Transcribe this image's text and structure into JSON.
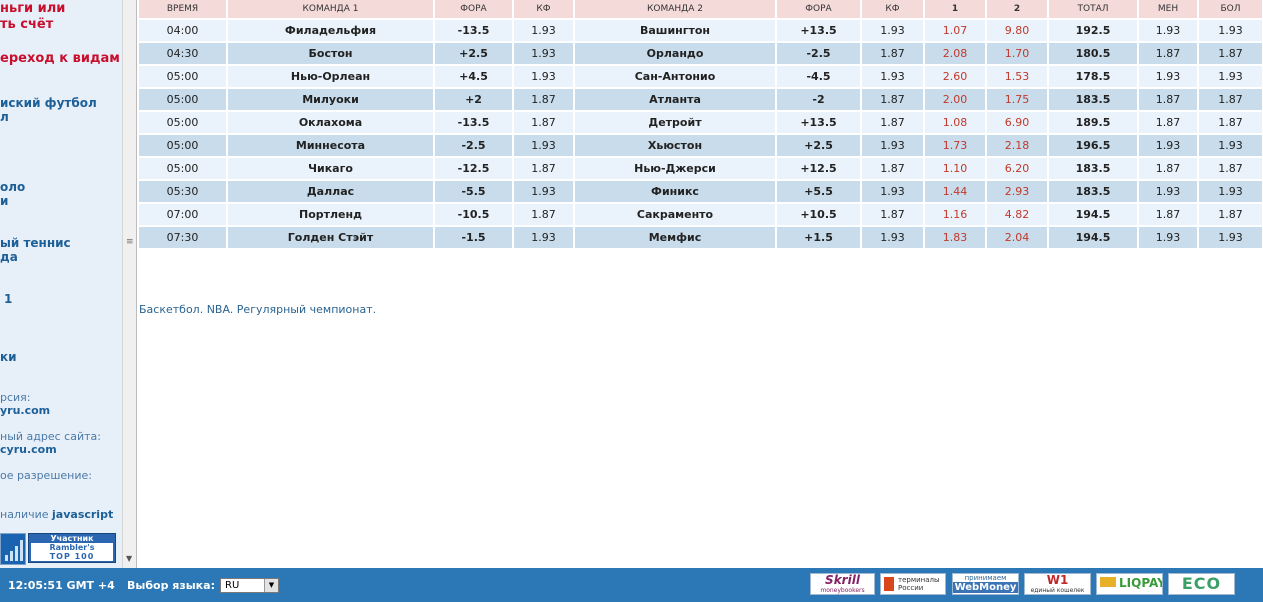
{
  "sidebar": {
    "items": [
      {
        "text": "ньги или",
        "style": "red"
      },
      {
        "text": "ть счёт",
        "style": "red"
      },
      {
        "text": "ереход к видам",
        "style": "red"
      },
      {
        "text": "иский футбол",
        "style": "blue"
      },
      {
        "text": "л",
        "style": "blue"
      },
      {
        "text": "оло",
        "style": "blue"
      },
      {
        "text": "и",
        "style": "blue"
      },
      {
        "text": "ый теннис",
        "style": "blue"
      },
      {
        "text": "да",
        "style": "blue"
      },
      {
        "text": "1",
        "style": "blue"
      },
      {
        "text": "ки",
        "style": "blue"
      }
    ],
    "mirror_label": "рсия:",
    "mirror_site": "yru.com",
    "address_label": "ный адрес сайта:",
    "address_site": "cyru.com",
    "resolution_label": "ое разрешение:",
    "js_prefix": "наличие ",
    "js_word": "javascript",
    "rambler": {
      "line1": "Участник",
      "line2": "Rambler's",
      "line3": "TOP 100"
    }
  },
  "table": {
    "headers": [
      "ВРЕМЯ",
      "КОМАНДА 1",
      "ФОРА",
      "КФ",
      "КОМАНДА 2",
      "ФОРА",
      "КФ",
      "1",
      "2",
      "ТОТАЛ",
      "МЕН",
      "БОЛ"
    ],
    "rows": [
      [
        "04:00",
        "Филадельфия",
        "-13.5",
        "1.93",
        "Вашингтон",
        "+13.5",
        "1.93",
        "1.07",
        "9.80",
        "192.5",
        "1.93",
        "1.93"
      ],
      [
        "04:30",
        "Бостон",
        "+2.5",
        "1.93",
        "Орландо",
        "-2.5",
        "1.87",
        "2.08",
        "1.70",
        "180.5",
        "1.87",
        "1.87"
      ],
      [
        "05:00",
        "Нью-Орлеан",
        "+4.5",
        "1.93",
        "Сан-Антонио",
        "-4.5",
        "1.93",
        "2.60",
        "1.53",
        "178.5",
        "1.93",
        "1.93"
      ],
      [
        "05:00",
        "Милуоки",
        "+2",
        "1.87",
        "Атланта",
        "-2",
        "1.87",
        "2.00",
        "1.75",
        "183.5",
        "1.87",
        "1.87"
      ],
      [
        "05:00",
        "Оклахома",
        "-13.5",
        "1.87",
        "Детройт",
        "+13.5",
        "1.87",
        "1.08",
        "6.90",
        "189.5",
        "1.87",
        "1.87"
      ],
      [
        "05:00",
        "Миннесота",
        "-2.5",
        "1.93",
        "Хьюстон",
        "+2.5",
        "1.93",
        "1.73",
        "2.18",
        "196.5",
        "1.93",
        "1.93"
      ],
      [
        "05:00",
        "Чикаго",
        "-12.5",
        "1.87",
        "Нью-Джерси",
        "+12.5",
        "1.87",
        "1.10",
        "6.20",
        "183.5",
        "1.87",
        "1.87"
      ],
      [
        "05:30",
        "Даллас",
        "-5.5",
        "1.93",
        "Финикс",
        "+5.5",
        "1.93",
        "1.44",
        "2.93",
        "183.5",
        "1.93",
        "1.93"
      ],
      [
        "07:00",
        "Портленд",
        "-10.5",
        "1.87",
        "Сакраменто",
        "+10.5",
        "1.87",
        "1.16",
        "4.82",
        "194.5",
        "1.87",
        "1.87"
      ],
      [
        "07:30",
        "Голден Стэйт",
        "-1.5",
        "1.93",
        "Мемфис",
        "+1.5",
        "1.93",
        "1.83",
        "2.04",
        "194.5",
        "1.93",
        "1.93"
      ]
    ]
  },
  "caption": "Баскетбол. NBA. Регулярный чемпионат.",
  "footer": {
    "clock": "12:05:51  GMT +4",
    "lang_label": "Выбор языка:",
    "lang_value": "RU",
    "payments": {
      "skrill": "Skrill",
      "skrill_sub": "moneybookers",
      "term1": "терминалы",
      "term2": "России",
      "wm1": "принимаем",
      "wm2": "WebMoney",
      "w1": "W1",
      "w1_sub": "единый кошелек",
      "liq": "LIQPAY",
      "eco": "ECO"
    }
  },
  "colors": {
    "header_bg": "#f5dada",
    "row_light": "#eaf3fb",
    "row_dark": "#c8dceb",
    "odds_red": "#c0392b",
    "footer_bg": "#2c78b6"
  }
}
